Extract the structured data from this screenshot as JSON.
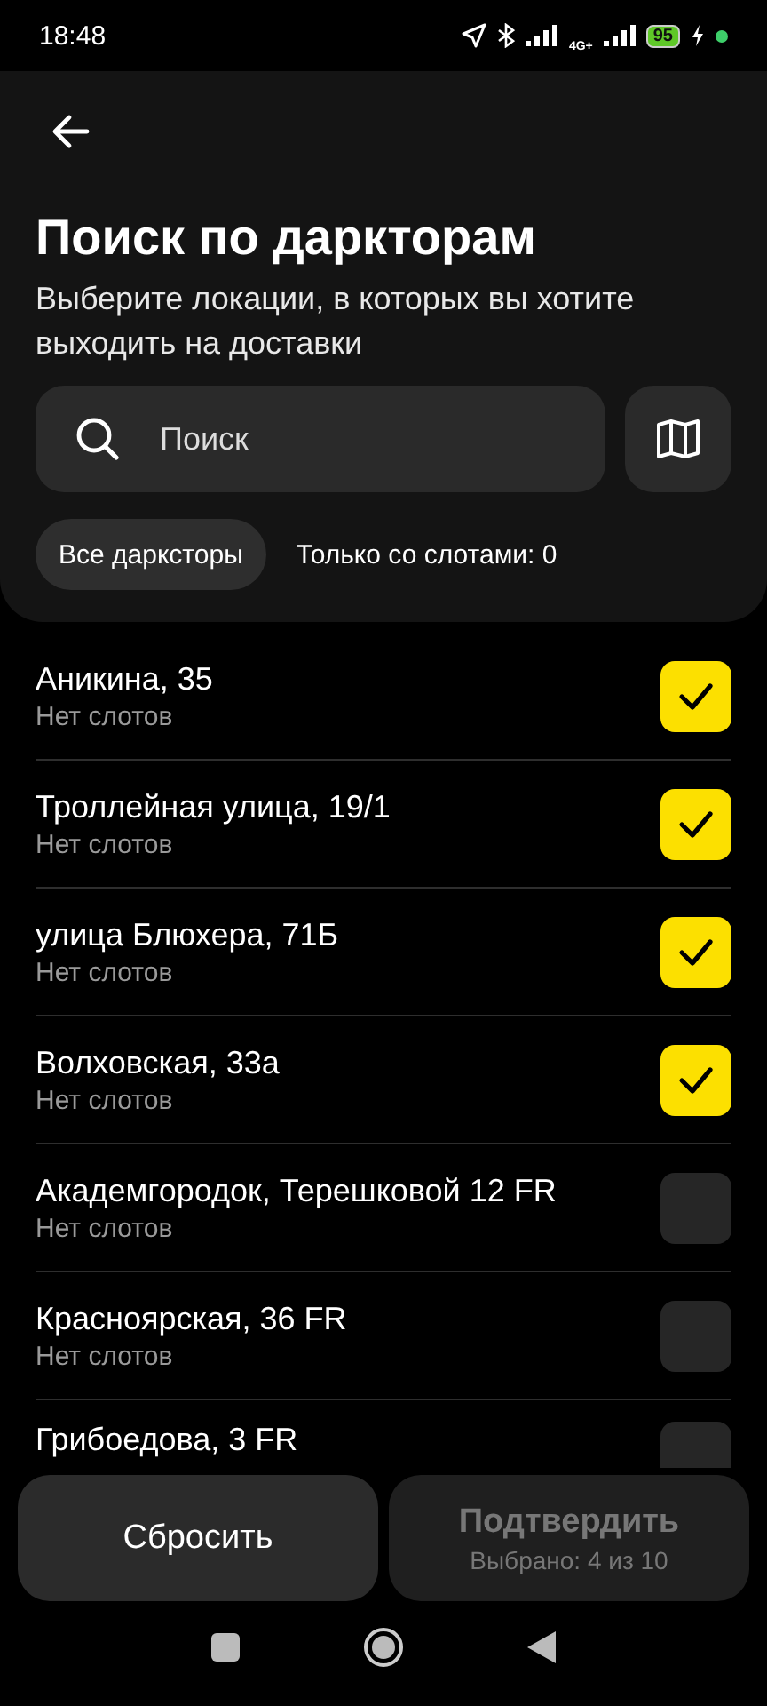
{
  "status_bar": {
    "time": "18:48",
    "network": "4G+",
    "battery": "95"
  },
  "header": {
    "title": "Поиск по даркторам",
    "subtitle": "Выберите локации, в которых вы хотите выходить на доставки"
  },
  "search": {
    "placeholder": "Поиск"
  },
  "filters": [
    {
      "label": "Все дарксторы",
      "selected": true
    },
    {
      "label": "Только со слотами: 0",
      "selected": false
    }
  ],
  "stores": [
    {
      "name": "Аникина, 35",
      "slots": "Нет слотов",
      "checked": true
    },
    {
      "name": "Троллейная улица, 19/1",
      "slots": "Нет слотов",
      "checked": true
    },
    {
      "name": "улица Блюхера, 71Б",
      "slots": "Нет слотов",
      "checked": true
    },
    {
      "name": "Волховская, 33а",
      "slots": "Нет слотов",
      "checked": true
    },
    {
      "name": "Академгородок, Терешковой 12 FR",
      "slots": "Нет слотов",
      "checked": false
    },
    {
      "name": "Красноярская, 36 FR",
      "slots": "Нет слотов",
      "checked": false
    },
    {
      "name": "Грибоедова, 3 FR",
      "checked": false
    }
  ],
  "footer": {
    "reset": "Сбросить",
    "confirm": {
      "label": "Подтвердить",
      "detail": "Выбрано: 4 из 10",
      "disabled": true
    }
  }
}
